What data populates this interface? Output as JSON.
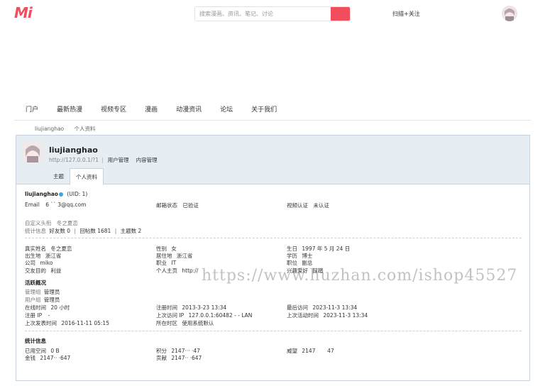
{
  "header": {
    "logo": "Mi",
    "search_placeholder": "搜索漫画、资讯、笔记、讨论",
    "scan_follow": "扫描+关注"
  },
  "nav": [
    "门户",
    "最新热漫",
    "视频专区",
    "漫画",
    "动漫资讯",
    "论坛",
    "关于我们"
  ],
  "breadcrumb": [
    "liujianghao",
    "个人资料"
  ],
  "profile": {
    "username": "liujianghao",
    "home_url": "http://127.0.0.1/?1",
    "actions": [
      "用户管理",
      "内容管理"
    ],
    "tabs": [
      "主题",
      "个人资料"
    ],
    "basic": {
      "name_line": "liujianghao",
      "uid": "(UID: 1)",
      "email_label": "Email",
      "email_value": "6    ``     3@qq.com",
      "email_status_label": "邮箱状态",
      "email_status_value": "已验证",
      "video_auth_label": "视频认证",
      "video_auth_value": "未认证",
      "custom_title_label": "自定义头衔",
      "custom_title_value": "冬之夏恋",
      "stats_label": "统计信息",
      "friends": "好友数 0",
      "replies": "回帖数 1681",
      "threads": "主题数 2"
    },
    "details": {
      "real_name_label": "真实姓名",
      "real_name": "冬之夏恋",
      "gender_label": "性别",
      "gender": "女",
      "birthday_label": "生日",
      "birthday": "1997 年 5 月 24 日",
      "birthplace_label": "出生地",
      "birthplace": "浙江省",
      "residence_label": "居住地",
      "residence": "浙江省",
      "education_label": "学历",
      "education": "博士",
      "company_label": "公司",
      "company": "miko",
      "occupation_label": "职业",
      "occupation": "IT",
      "position_label": "职位",
      "position": "副总",
      "purpose_label": "交友目的",
      "purpose": "利益",
      "homepage_label": "个人主页",
      "homepage": "http://",
      "hobby_label": "兴趣爱好",
      "hobby": "踩踏"
    },
    "activity": {
      "title": "活跃概况",
      "admin_group_label": "管理组",
      "admin_group": "管理员",
      "user_group_label": "用户组",
      "user_group": "管理员",
      "online_label": "在线时间",
      "online": "20 小时",
      "reg_time_label": "注册时间",
      "reg_time": "2013-3-23 13:34",
      "last_visit_label": "最后访问",
      "last_visit": "2023-11-3 13:34",
      "reg_ip_label": "注册 IP",
      "reg_ip": "-",
      "last_ip_label": "上次访问 IP",
      "last_ip": "127.0.0.1:60482 - - LAN",
      "last_active_label": "上次活动时间",
      "last_active": "2023-11-3 13:34",
      "last_post_label": "上次发表时间",
      "last_post": "2016-11-11 05:15",
      "timezone_label": "所在时区",
      "timezone": "使用系统默认"
    },
    "stats": {
      "title": "统计信息",
      "space_label": "已用空间",
      "space": "0 B",
      "points_label": "积分",
      "points": "2147··· ·47",
      "prestige_label": "威望",
      "prestige": "2147       47",
      "money_label": "金钱",
      "money": "2147·· ·647",
      "contribution_label": "贡献",
      "contribution": "2147·· ·647"
    }
  },
  "watermark": "https://www.huzhan.com/ishop45527",
  "colors": {
    "accent": "#f04d5d",
    "panel_bg": "#e6edf3",
    "border": "#c9d3dd"
  }
}
